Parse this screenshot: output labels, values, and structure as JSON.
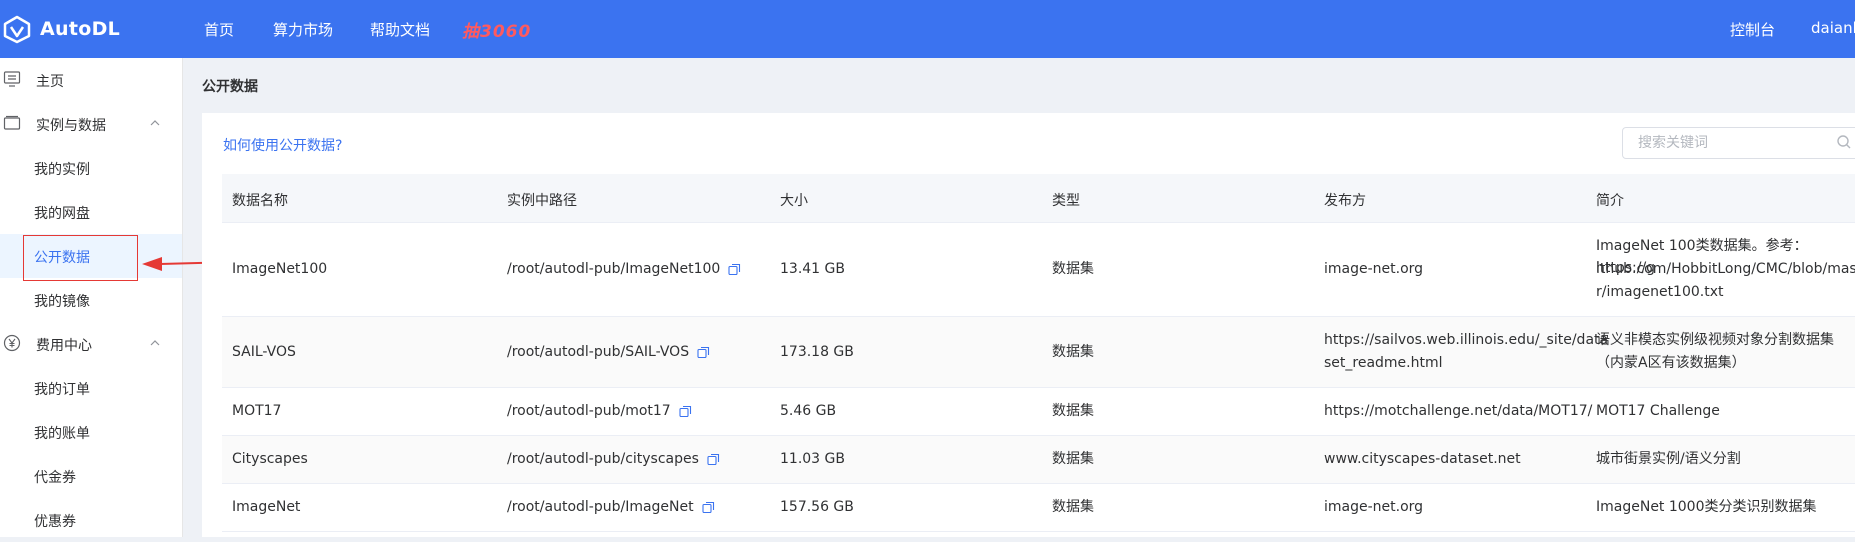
{
  "header": {
    "logo_text": "AutoDL",
    "nav": [
      "首页",
      "算力市场",
      "帮助文档"
    ],
    "promo": "抽3060",
    "console": "控制台",
    "user": "daianb"
  },
  "sidebar": {
    "items": [
      {
        "label": "主页",
        "icon": "home-icon"
      },
      {
        "label": "实例与数据",
        "icon": "folder-icon",
        "expandable": true
      },
      {
        "label": "我的实例"
      },
      {
        "label": "我的网盘"
      },
      {
        "label": "公开数据",
        "active": true
      },
      {
        "label": "我的镜像"
      },
      {
        "label": "费用中心",
        "icon": "yen-icon",
        "expandable": true
      },
      {
        "label": "我的订单"
      },
      {
        "label": "我的账单"
      },
      {
        "label": "代金券"
      },
      {
        "label": "优惠券"
      }
    ]
  },
  "main": {
    "breadcrumb": "公开数据",
    "help_link": "如何使用公开数据?",
    "search_placeholder": "搜索关键词",
    "columns": [
      "数据名称",
      "实例中路径",
      "大小",
      "类型",
      "发布方",
      "简介"
    ],
    "rows": [
      {
        "name": "ImageNet100",
        "path": "/root/autodl-pub/ImageNet100",
        "size": "13.41 GB",
        "type": "数据集",
        "publisher": [
          "image-net.org"
        ],
        "desc": [
          "ImageNet 100类数据集。参考：https://g",
          "ithub.com/HobbitLong/CMC/blob/maste",
          "r/imagenet100.txt"
        ]
      },
      {
        "name": "SAIL-VOS",
        "path": "/root/autodl-pub/SAIL-VOS",
        "size": "173.18 GB",
        "type": "数据集",
        "publisher": [
          "https://sailvos.web.illinois.edu/_site/data",
          "set_readme.html"
        ],
        "desc": [
          "语义非模态实例级视频对象分割数据集",
          "（内蒙A区有该数据集）"
        ]
      },
      {
        "name": "MOT17",
        "path": "/root/autodl-pub/mot17",
        "size": "5.46 GB",
        "type": "数据集",
        "publisher": [
          "https://motchallenge.net/data/MOT17/"
        ],
        "desc": [
          "MOT17 Challenge"
        ]
      },
      {
        "name": "Cityscapes",
        "path": "/root/autodl-pub/cityscapes",
        "size": "11.03 GB",
        "type": "数据集",
        "publisher": [
          "www.cityscapes-dataset.net"
        ],
        "desc": [
          "城市街景实例/语义分割"
        ]
      },
      {
        "name": "ImageNet",
        "path": "/root/autodl-pub/ImageNet",
        "size": "157.56 GB",
        "type": "数据集",
        "publisher": [
          "image-net.org"
        ],
        "desc": [
          "ImageNet 1000类分类识别数据集"
        ]
      }
    ]
  },
  "colors": {
    "brand": "#3b73f0",
    "promo": "#ff5a5f",
    "annotation": "#e53935"
  }
}
